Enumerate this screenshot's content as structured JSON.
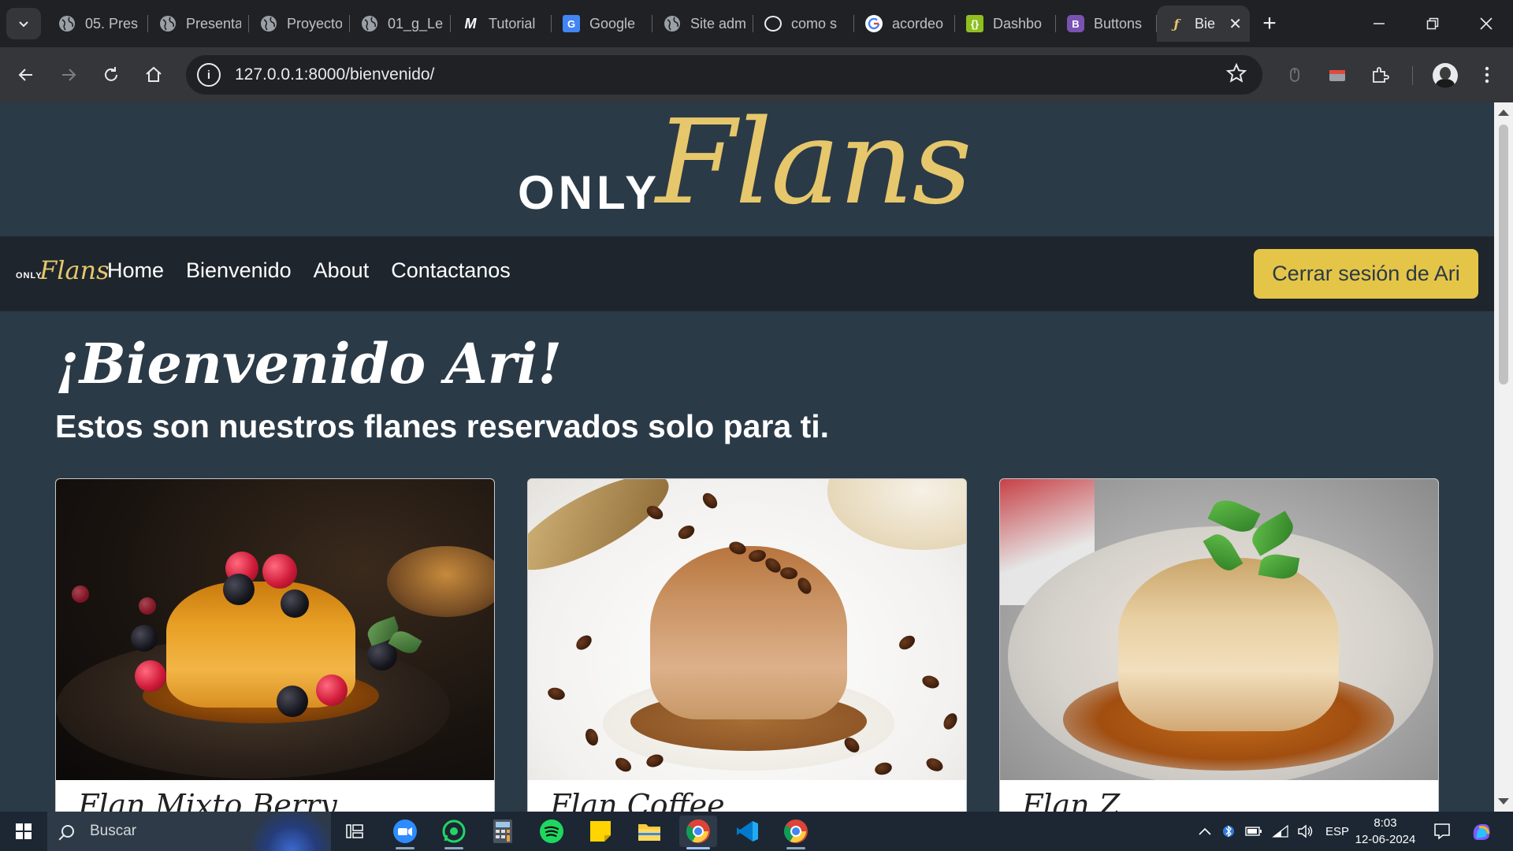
{
  "browser": {
    "tabs": [
      {
        "title": "05. Pres",
        "icon": "globe-icon",
        "color": "#bdc1c6"
      },
      {
        "title": "Presenta",
        "icon": "globe-icon",
        "color": "#bdc1c6"
      },
      {
        "title": "Proyecto",
        "icon": "globe-icon",
        "color": "#bdc1c6"
      },
      {
        "title": "01_g_Le",
        "icon": "globe-icon",
        "color": "#bdc1c6"
      },
      {
        "title": "Tutorial",
        "icon": "m-logo-icon",
        "color": "#ffffff"
      },
      {
        "title": "Google",
        "icon": "google-translate-icon",
        "color": "#4285f4"
      },
      {
        "title": "Site adm",
        "icon": "globe-icon",
        "color": "#bdc1c6"
      },
      {
        "title": "como s",
        "icon": "chatgpt-icon",
        "color": "#e8eaed"
      },
      {
        "title": "acordeo",
        "icon": "google-icon",
        "color": "#ffffff"
      },
      {
        "title": "Dashbo",
        "icon": "curly-braces-icon",
        "color": "#8fbf1f"
      },
      {
        "title": "Buttons",
        "icon": "bootstrap-icon",
        "color": "#7952b3"
      },
      {
        "title": "Bie",
        "icon": "flans-favicon-icon",
        "color": "#e6c76b"
      }
    ],
    "url": "127.0.0.1:8000/bienvenido/"
  },
  "site": {
    "logo_only": "ONLY",
    "logo_flans": "Flans",
    "nav": {
      "brand_only": "ONLY",
      "brand_flans": "Flans",
      "links": [
        "Home",
        "Bienvenido",
        "About",
        "Contactanos"
      ],
      "logout": "Cerrar sesión de Ari"
    },
    "welcome": "¡Bienvenido Ari!",
    "subtitle": "Estos son nuestros flanes reservados solo para ti.",
    "cards": [
      {
        "title": "Flan Mixto Berry"
      },
      {
        "title": "Flan Coffee"
      },
      {
        "title": "Flan Z"
      }
    ],
    "colors": {
      "accent": "#e5c547",
      "brand_gold": "#e6c76b",
      "page_bg": "#2b3a47",
      "nav_bg": "#1e252c"
    }
  },
  "taskbar": {
    "search_placeholder": "Buscar",
    "language": "ESP",
    "time": "8:03",
    "date": "12-06-2024"
  }
}
